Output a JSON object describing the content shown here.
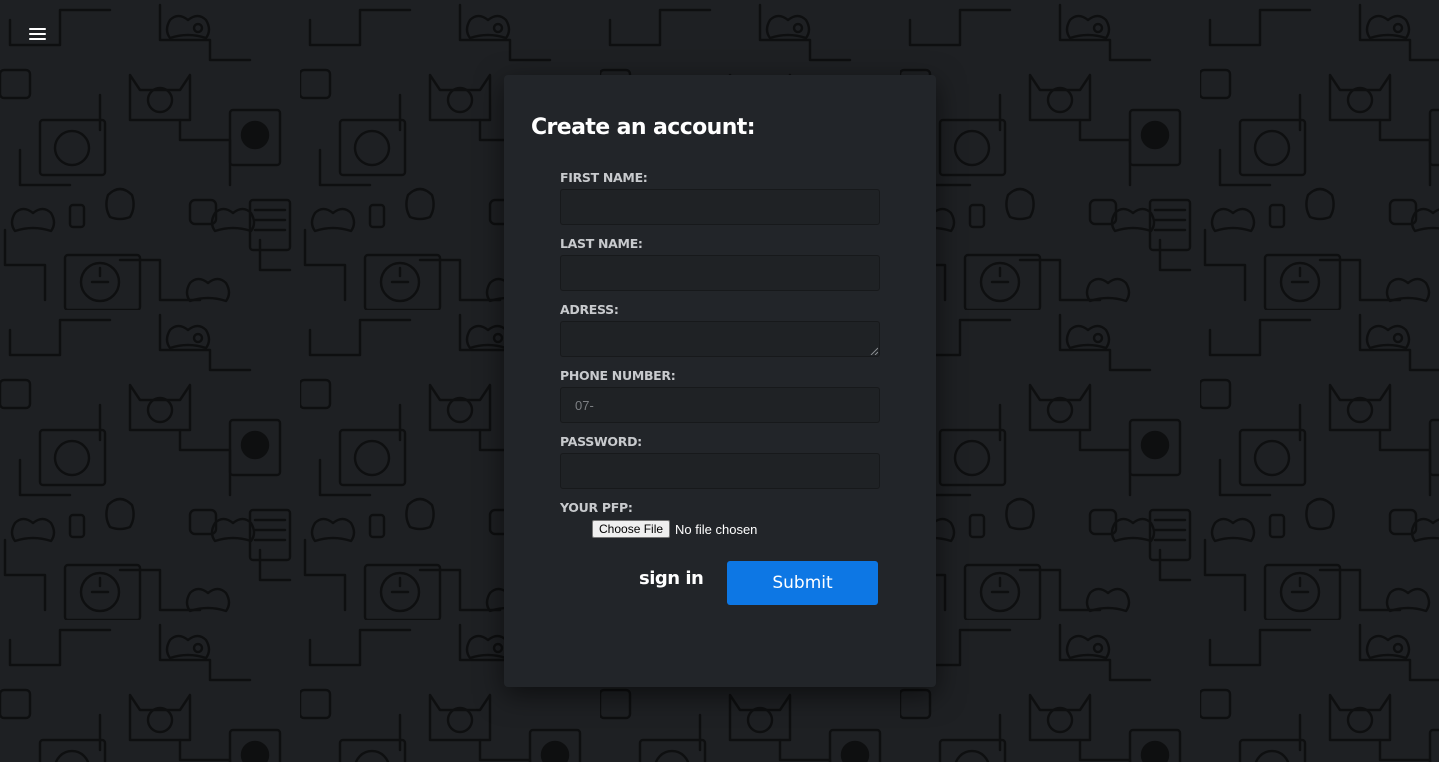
{
  "colors": {
    "page_background": "#1e2023",
    "pattern_stroke": "#0e0f10",
    "card_background": "#222529",
    "input_background": "#1f2225",
    "label_text": "#c8cacd",
    "accent": "#0d77e4",
    "text": "#ffffff"
  },
  "header": {
    "menu_icon": "hamburger-menu-icon"
  },
  "background": {
    "pattern_icons": [
      "gamepad-icon",
      "retro-console-icon",
      "cat-console-icon",
      "discord-icon",
      "handheld-icon",
      "joystick-icon"
    ]
  },
  "form": {
    "title": "Create an account:",
    "fields": [
      {
        "label": "FIRST NAME:",
        "value": "",
        "placeholder": ""
      },
      {
        "label": "LAST NAME:",
        "value": "",
        "placeholder": ""
      },
      {
        "label": "ADRESS:",
        "value": "",
        "placeholder": ""
      },
      {
        "label": "PHONE NUMBER:",
        "value": "",
        "placeholder": "07-"
      },
      {
        "label": "PASSWORD:",
        "value": "",
        "placeholder": ""
      }
    ],
    "pfp": {
      "label": "YOUR PFP:",
      "button_label": "Choose File",
      "status": "No file chosen"
    },
    "signin_label": "sign in",
    "submit_label": "Submit"
  }
}
